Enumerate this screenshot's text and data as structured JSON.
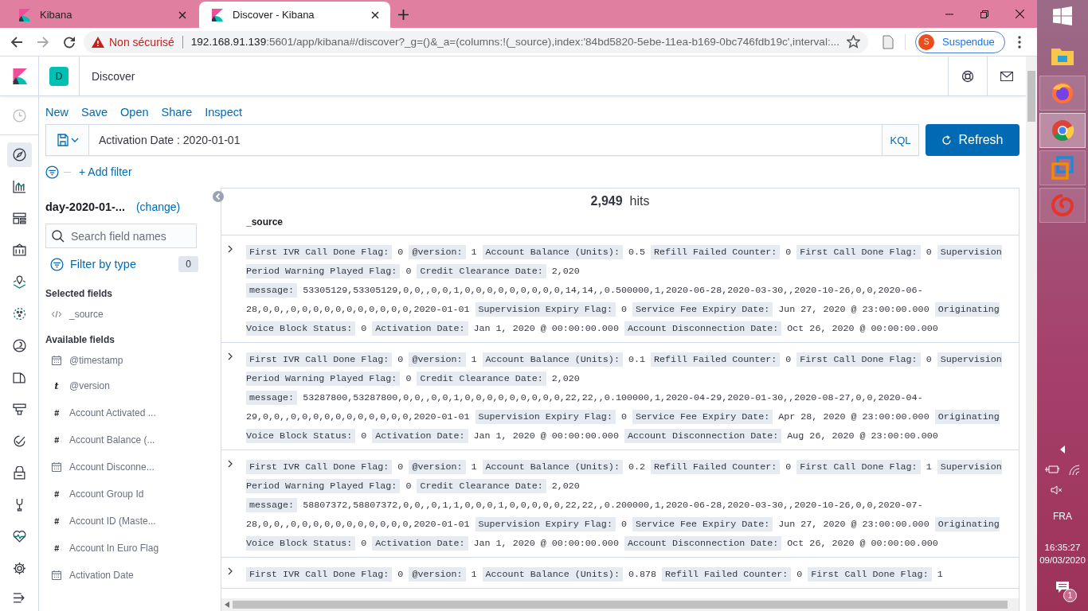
{
  "browser": {
    "tabs": [
      {
        "title": "Kibana",
        "selected": false
      },
      {
        "title": "Discover - Kibana",
        "selected": true
      }
    ],
    "address": {
      "warning": "Non sécurisé",
      "host": "192.168.91.139",
      "path": ":5601/app/kibana#/discover?_g=()&_a=(columns:!(_source),index:'84bd5820-5ebe-11ea-b169-0bc746fdb19c',interval:..."
    },
    "profile": {
      "initial": "S",
      "label": "Suspendue"
    }
  },
  "kibana": {
    "app_badge": "D",
    "app_title": "Discover",
    "nav": [
      {
        "kind": "recent",
        "selected": false
      },
      {
        "kind": "discover",
        "selected": true
      },
      {
        "kind": "visualize",
        "selected": false
      },
      {
        "kind": "dashboard",
        "selected": false
      },
      {
        "kind": "canvas",
        "selected": false
      },
      {
        "kind": "maps",
        "selected": false
      },
      {
        "kind": "ml",
        "selected": false
      },
      {
        "kind": "siem",
        "selected": false
      },
      {
        "kind": "graph",
        "selected": false
      },
      {
        "kind": "apm",
        "selected": false
      },
      {
        "kind": "uptime",
        "selected": false
      },
      {
        "kind": "lock",
        "selected": false
      },
      {
        "kind": "devtools",
        "selected": false
      },
      {
        "kind": "monitoring",
        "selected": false
      },
      {
        "kind": "settings",
        "selected": false
      },
      {
        "kind": "collapse",
        "selected": false
      }
    ],
    "top_menu": [
      "New",
      "Save",
      "Open",
      "Share",
      "Inspect"
    ],
    "query": "Activation Date : 2020-01-01",
    "language": "KQL",
    "refresh": "Refresh",
    "add_filter": "+ Add filter",
    "sidebar": {
      "index_pattern": "day-2020-01-...",
      "change": "(change)",
      "search_placeholder": "Search field names",
      "filter_by_type": "Filter by type",
      "filter_count": "0",
      "selected_title": "Selected fields",
      "selected_fields": [
        {
          "kind": "source",
          "name": "_source"
        }
      ],
      "available_title": "Available fields",
      "available_fields": [
        {
          "kind": "date",
          "name": "@timestamp"
        },
        {
          "kind": "string",
          "glyph": "t",
          "name": "@version"
        },
        {
          "kind": "number",
          "glyph": "#",
          "name": "Account Activated ..."
        },
        {
          "kind": "number",
          "glyph": "#",
          "name": "Account Balance (..."
        },
        {
          "kind": "date",
          "name": "Account Disconne..."
        },
        {
          "kind": "number",
          "glyph": "#",
          "name": "Account Group Id"
        },
        {
          "kind": "number",
          "glyph": "#",
          "name": "Account ID (Maste..."
        },
        {
          "kind": "number",
          "glyph": "#",
          "name": "Account In Euro Flag"
        },
        {
          "kind": "date",
          "name": "Activation Date"
        }
      ]
    },
    "hits": {
      "count": "2,949",
      "label": "hits"
    },
    "column": "_source",
    "documents": [
      {
        "fields": [
          {
            "key": "First IVR Call Done Flag:",
            "value": "0"
          },
          {
            "key": "@version:",
            "value": "1"
          },
          {
            "key": "Account Balance (Units):",
            "value": "0.5"
          },
          {
            "key": "Refill Failed Counter:",
            "value": "0"
          },
          {
            "key": "First Call Done Flag:",
            "value": "0"
          },
          {
            "key": "Supervision Period Warning Played Flag:",
            "value": "0"
          },
          {
            "key": "Credit Clearance Date:",
            "value": "2,020"
          },
          {
            "key": "message:",
            "value": "53305129,53305129,0,0,,0,0,1,0,0,0,0,0,0,0,0,0,14,14,,0.500000,1,2020-06-28,2020-03-30,,2020-10-26,0,0,2020-06-28,0,0,,0,0,0,0,0,0,0,0,0,0,0,2020-01-01"
          },
          {
            "key": "Supervision Expiry Flag:",
            "value": "0"
          },
          {
            "key": "Service Fee Expiry Date:",
            "value": "Jun 27, 2020 @ 23:00:00.000"
          },
          {
            "key": "Originating Voice Block Status:",
            "value": "0"
          },
          {
            "key": "Activation Date:",
            "value": "Jan 1, 2020 @ 00:00:00.000"
          },
          {
            "key": "Account Disconnection Date:",
            "value": "Oct 26, 2020 @ 00:00:00.000"
          }
        ]
      },
      {
        "fields": [
          {
            "key": "First IVR Call Done Flag:",
            "value": "0"
          },
          {
            "key": "@version:",
            "value": "1"
          },
          {
            "key": "Account Balance (Units):",
            "value": "0.1"
          },
          {
            "key": "Refill Failed Counter:",
            "value": "0"
          },
          {
            "key": "First Call Done Flag:",
            "value": "0"
          },
          {
            "key": "Supervision Period Warning Played Flag:",
            "value": "0"
          },
          {
            "key": "Credit Clearance Date:",
            "value": "2,020"
          },
          {
            "key": "message:",
            "value": "53287800,53287800,0,0,,0,0,1,0,0,0,0,0,0,0,0,0,22,22,,0.100000,1,2020-04-29,2020-01-30,,2020-08-27,0,0,2020-04-29,0,0,,0,0,0,0,0,0,0,0,0,0,0,2020-01-01"
          },
          {
            "key": "Supervision Expiry Flag:",
            "value": "0"
          },
          {
            "key": "Service Fee Expiry Date:",
            "value": "Apr 28, 2020 @ 23:00:00.000"
          },
          {
            "key": "Originating Voice Block Status:",
            "value": "0"
          },
          {
            "key": "Activation Date:",
            "value": "Jan 1, 2020 @ 00:00:00.000"
          },
          {
            "key": "Account Disconnection Date:",
            "value": "Aug 26, 2020 @ 23:00:00.000"
          }
        ]
      },
      {
        "fields": [
          {
            "key": "First IVR Call Done Flag:",
            "value": "0"
          },
          {
            "key": "@version:",
            "value": "1"
          },
          {
            "key": "Account Balance (Units):",
            "value": "0.2"
          },
          {
            "key": "Refill Failed Counter:",
            "value": "0"
          },
          {
            "key": "First Call Done Flag:",
            "value": "1"
          },
          {
            "key": "Supervision Period Warning Played Flag:",
            "value": "0"
          },
          {
            "key": "Credit Clearance Date:",
            "value": "2,020"
          },
          {
            "key": "message:",
            "value": "58807372,58807372,0,0,,0,1,1,0,0,0,1,0,0,0,0,0,22,22,,0.200000,1,2020-06-28,2020-03-30,,2020-10-26,0,0,2020-07-28,0,0,,0,0,0,0,0,0,0,0,0,0,0,2020-01-01"
          },
          {
            "key": "Supervision Expiry Flag:",
            "value": "0"
          },
          {
            "key": "Service Fee Expiry Date:",
            "value": "Jun 27, 2020 @ 23:00:00.000"
          },
          {
            "key": "Originating Voice Block Status:",
            "value": "0"
          },
          {
            "key": "Activation Date:",
            "value": "Jan 1, 2020 @ 00:00:00.000"
          },
          {
            "key": "Account Disconnection Date:",
            "value": "Oct 26, 2020 @ 00:00:00.000"
          }
        ]
      },
      {
        "fields": [
          {
            "key": "First IVR Call Done Flag:",
            "value": "0"
          },
          {
            "key": "@version:",
            "value": "1"
          },
          {
            "key": "Account Balance (Units):",
            "value": "0.878"
          },
          {
            "key": "Refill Failed Counter:",
            "value": "0"
          },
          {
            "key": "First Call Done Flag:",
            "value": "1"
          }
        ]
      }
    ]
  },
  "taskbar": {
    "apps": [
      {
        "kind": "folder",
        "running": false,
        "selected": false
      },
      {
        "kind": "firefox",
        "running": true,
        "selected": false
      },
      {
        "kind": "chrome",
        "running": true,
        "selected": true
      },
      {
        "kind": "vm",
        "running": true,
        "selected": false
      },
      {
        "kind": "swirl",
        "running": true,
        "selected": false
      }
    ],
    "language": "FRA",
    "time": "16:35:27",
    "date": "09/03/2020",
    "notifications": "1"
  }
}
